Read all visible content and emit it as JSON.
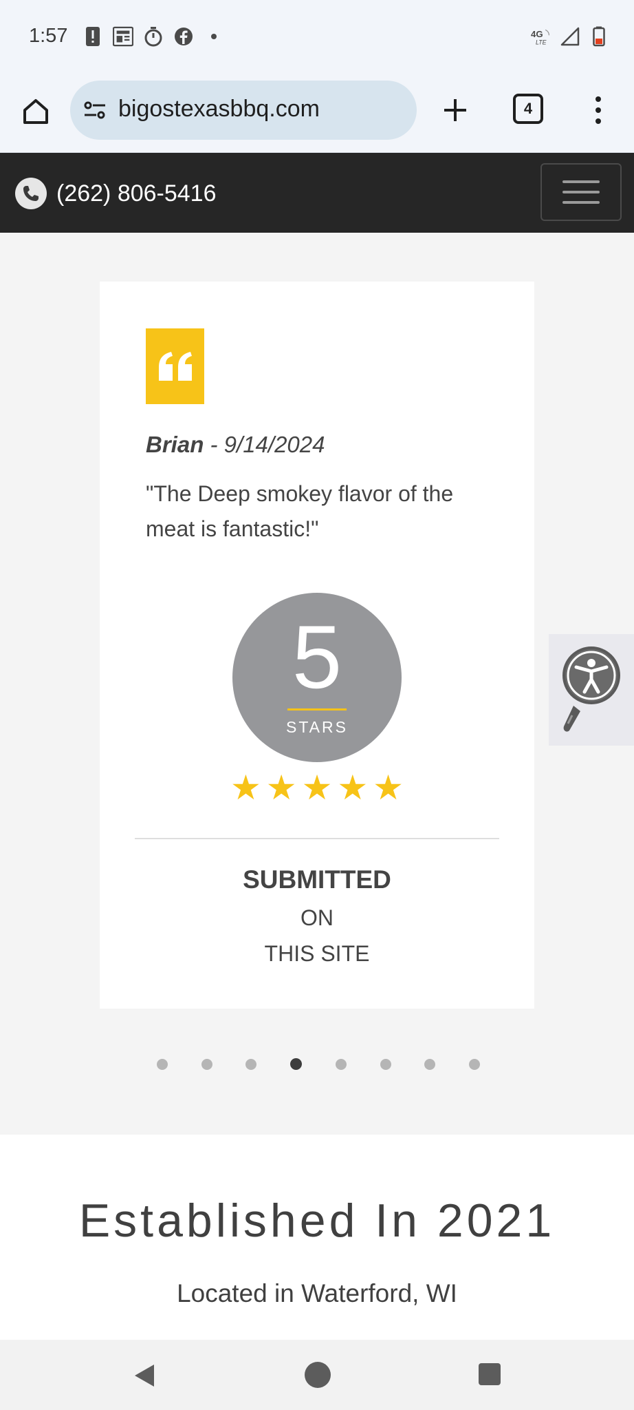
{
  "status_bar": {
    "time": "1:57",
    "left_icons": [
      "alert-icon",
      "news-icon",
      "timer-icon",
      "facebook-icon",
      "dot-icon"
    ],
    "network": "4G LTE",
    "right_icons": [
      "network-4g-lte-icon",
      "signal-icon",
      "battery-icon"
    ]
  },
  "browser": {
    "url": "bigostexasbbq.com",
    "tab_count": "4"
  },
  "header": {
    "phone": "(262) 806-5416"
  },
  "testimonial": {
    "author": "Brian",
    "date_sep": " - 9/14/2024",
    "text": "\"The Deep smokey flavor of the meat is fantastic!\"",
    "rating": "5",
    "rating_label": "STARS",
    "stars": 5,
    "submitted": "SUBMITTED",
    "on": "ON",
    "site": "THIS SITE"
  },
  "carousel": {
    "total": 8,
    "active_index": 3
  },
  "established": {
    "title": "Established In 2021",
    "subtitle": "Located in Waterford, WI"
  },
  "colors": {
    "accent": "#f7c318",
    "header_bg": "#262626",
    "rating_circle": "#96979a"
  }
}
